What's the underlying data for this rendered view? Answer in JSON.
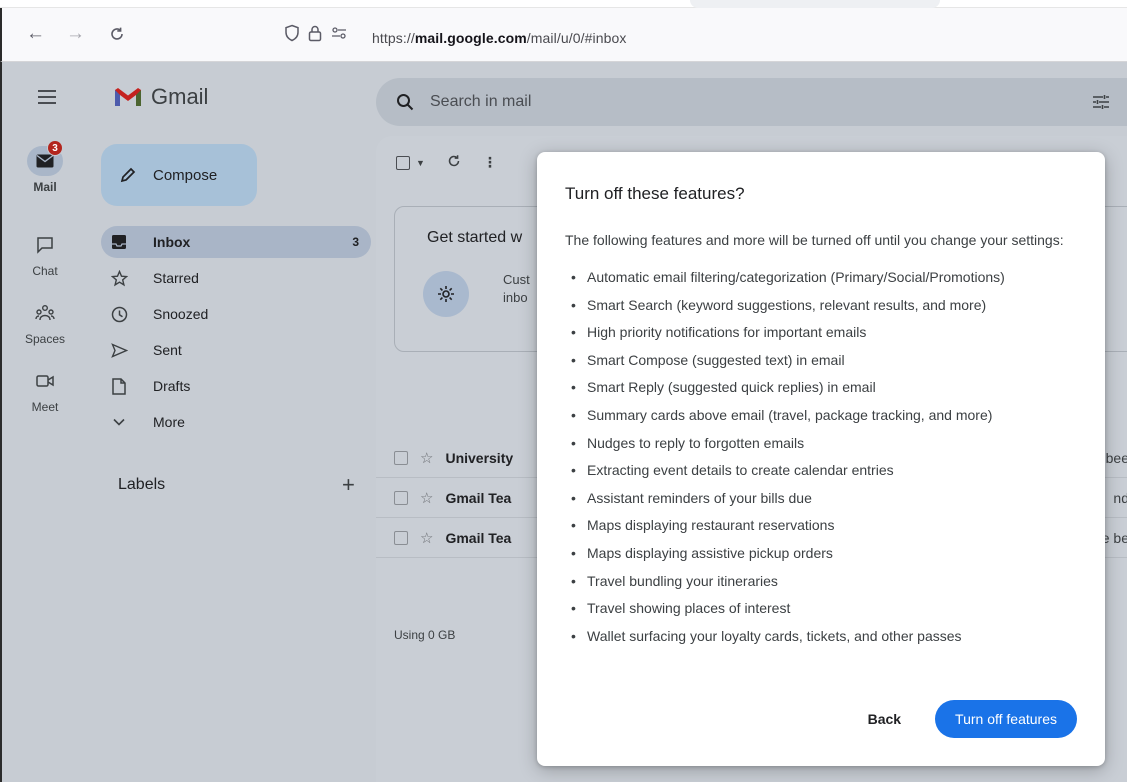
{
  "browser": {
    "url_prefix": "https://",
    "url_domain": "mail.google.com",
    "url_path": "/mail/u/0/#inbox"
  },
  "rail": {
    "items": [
      {
        "label": "Mail",
        "badge": "3"
      },
      {
        "label": "Chat"
      },
      {
        "label": "Spaces"
      },
      {
        "label": "Meet"
      }
    ]
  },
  "sidebar": {
    "logo_text": "Gmail",
    "compose_label": "Compose",
    "items": [
      {
        "label": "Inbox",
        "count": "3"
      },
      {
        "label": "Starred"
      },
      {
        "label": "Snoozed"
      },
      {
        "label": "Sent"
      },
      {
        "label": "Drafts"
      },
      {
        "label": "More"
      }
    ],
    "labels_heading": "Labels",
    "labels_add": "+"
  },
  "main": {
    "search_placeholder": "Search in mail",
    "get_started_title": "Get started w",
    "get_started_text_1": "Cust",
    "get_started_text_2": "inbo",
    "rows": [
      {
        "sender": "University",
        "tail": "bee"
      },
      {
        "sender": "Gmail Tea",
        "tail": "nd"
      },
      {
        "sender": "Gmail Tea",
        "tail": "e be"
      }
    ],
    "storage": "Using 0 GB"
  },
  "dialog": {
    "title": "Turn off these features?",
    "intro": "The following features and more will be turned off until you change your settings:",
    "features": [
      "Automatic email filtering/categorization (Primary/Social/Promotions)",
      "Smart Search (keyword suggestions, relevant results, and more)",
      "High priority notifications for important emails",
      "Smart Compose (suggested text) in email",
      "Smart Reply (suggested quick replies) in email",
      "Summary cards above email (travel, package tracking, and more)",
      "Nudges to reply to forgotten emails",
      "Extracting event details to create calendar entries",
      "Assistant reminders of your bills due",
      "Maps displaying restaurant reservations",
      "Maps displaying assistive pickup orders",
      "Travel bundling your itineraries",
      "Travel showing places of interest",
      "Wallet surfacing your loyalty cards, tickets, and other passes"
    ],
    "back_label": "Back",
    "primary_label": "Turn off features"
  },
  "colors": {
    "primary_button": "#1a73e8",
    "badge": "#b3261e",
    "overlay_bg": "#c7ccd3"
  }
}
